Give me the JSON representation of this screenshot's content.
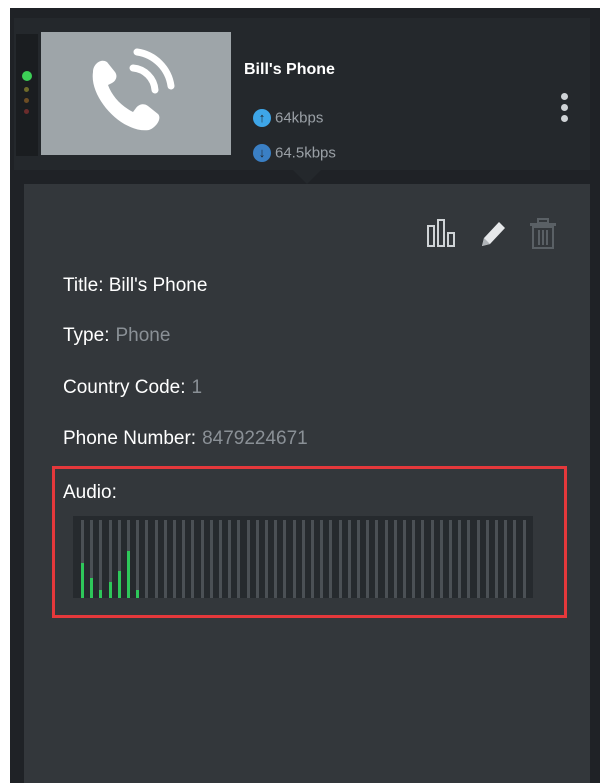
{
  "device": {
    "title": "Bill's Phone",
    "upload_rate": "64kbps",
    "download_rate": "64.5kbps",
    "status_colors": [
      "#3ccf56",
      "#6e6a2a",
      "#6d4d24",
      "#6b2c2c"
    ],
    "thumbnail_icon": "phone-ringing-icon"
  },
  "toolbar": {
    "icons": [
      "bar-chart-icon",
      "pencil-icon",
      "trash-icon"
    ]
  },
  "details": {
    "title_label": "Title:",
    "title_value": "Bill's Phone",
    "type_label": "Type:",
    "type_value": "Phone",
    "country_label": "Country Code:",
    "country_value": "1",
    "phone_label": "Phone Number:",
    "phone_value": "8479224671",
    "audio_label": "Audio:"
  },
  "audio_meter": {
    "bar_count": 49,
    "levels": [
      0.45,
      0.25,
      0.1,
      0.2,
      0.35,
      0.6,
      0.1,
      0,
      0
    ],
    "level_color": "#2ec75a",
    "highlight_color": "#e5383b"
  }
}
